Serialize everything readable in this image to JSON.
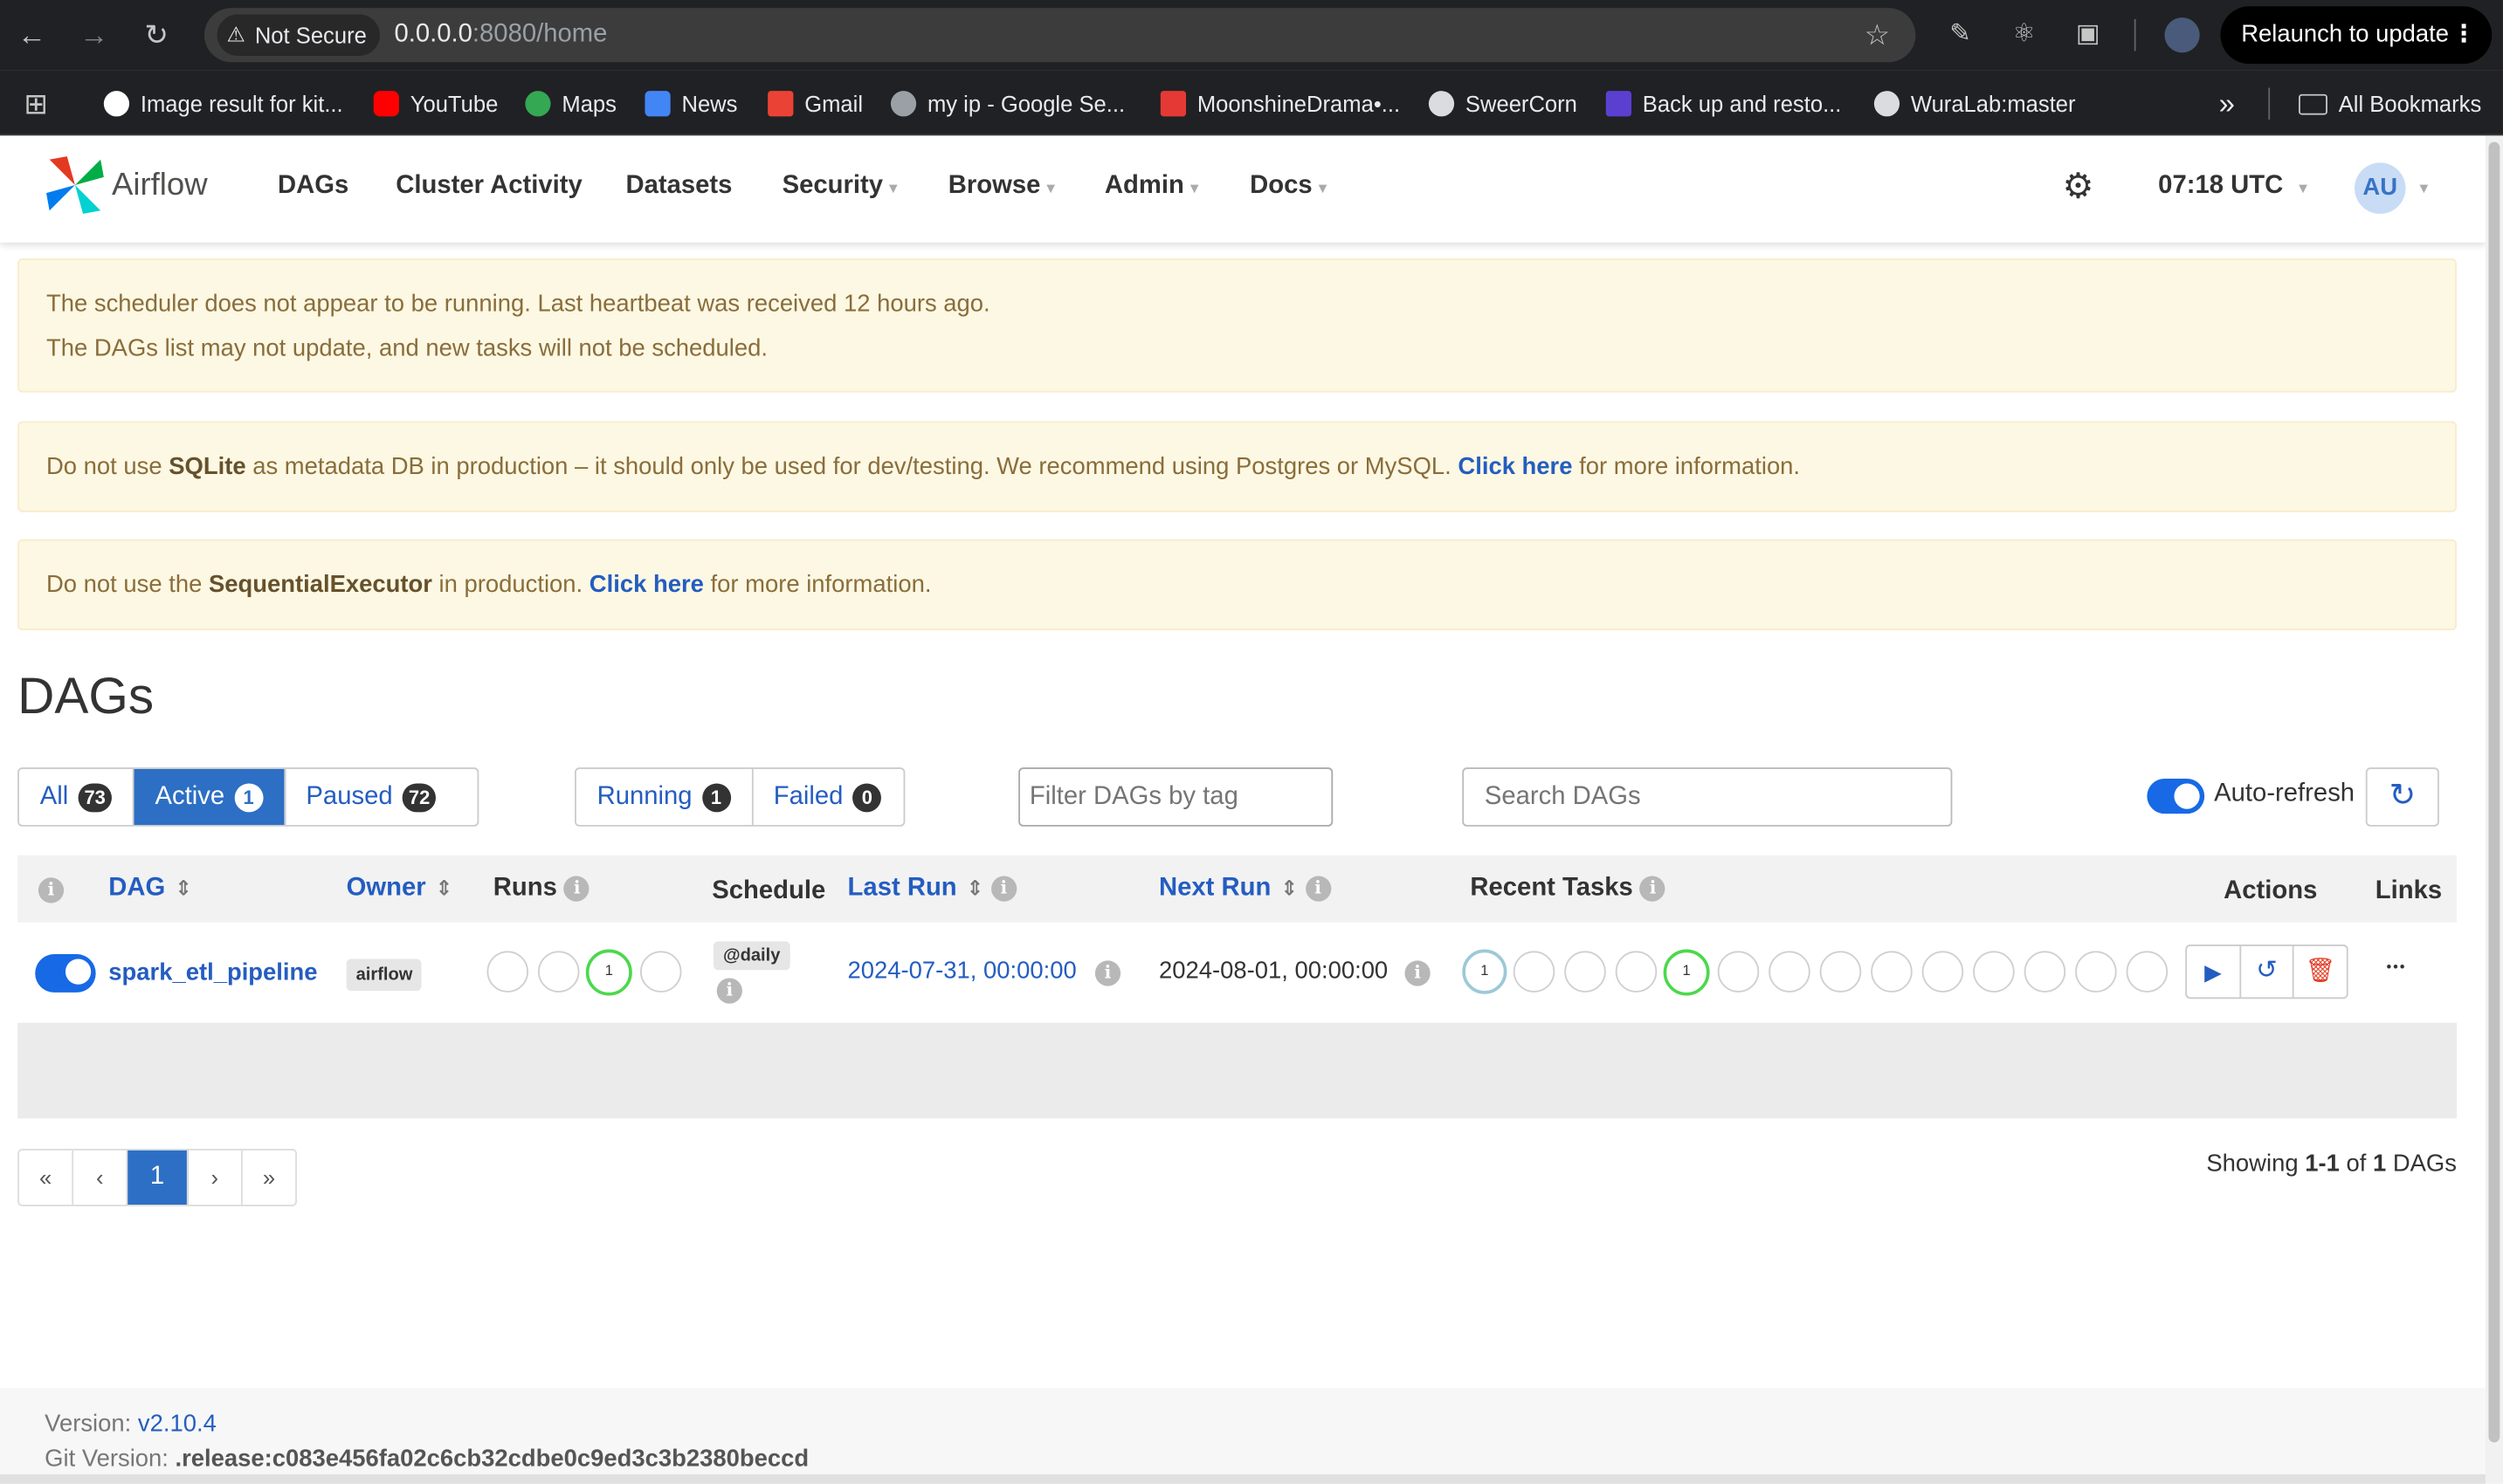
{
  "browser": {
    "not_secure": "Not Secure",
    "url_host": "0.0.0.0",
    "url_rest": ":8080/home",
    "relaunch": "Relaunch to update",
    "bookmarks": [
      {
        "label": "Image result for kit...",
        "color": "#ffffff"
      },
      {
        "label": "YouTube",
        "color": "#ff0000"
      },
      {
        "label": "Maps",
        "color": "#34a853"
      },
      {
        "label": "News",
        "color": "#4285f4"
      },
      {
        "label": "Gmail",
        "color": "#ea4335"
      },
      {
        "label": "my ip - Google Se...",
        "color": "#9aa0a6"
      },
      {
        "label": "MoonshineDrama•...",
        "color": "#e53935"
      },
      {
        "label": "SweerCorn",
        "color": "#dadce0"
      },
      {
        "label": "Back up and resto...",
        "color": "#5b3fd1"
      },
      {
        "label": "WuraLab:master",
        "color": "#dadce0"
      }
    ],
    "all_bookmarks": "All Bookmarks",
    "overflow": "»"
  },
  "nav": {
    "logo": "Airflow",
    "items": [
      "DAGs",
      "Cluster Activity",
      "Datasets",
      "Security",
      "Browse",
      "Admin",
      "Docs"
    ],
    "time": "07:18 UTC",
    "avatar": "AU"
  },
  "alerts": {
    "scheduler_line1": "The scheduler does not appear to be running. Last heartbeat was received 12 hours ago.",
    "scheduler_line2": "The DAGs list may not update, and new tasks will not be scheduled.",
    "sqlite_pre": "Do not use ",
    "sqlite_b": "SQLite",
    "sqlite_mid": " as metadata DB in production – it should only be used for dev/testing. We recommend using Postgres or MySQL. ",
    "sqlite_link": "Click here",
    "sqlite_post": " for more information.",
    "exec_pre": "Do not use the ",
    "exec_b": "SequentialExecutor",
    "exec_mid": " in production. ",
    "exec_link": "Click here",
    "exec_post": " for more information."
  },
  "page_title": "DAGs",
  "filters": {
    "all": {
      "label": "All",
      "count": "73"
    },
    "active": {
      "label": "Active",
      "count": "1"
    },
    "paused": {
      "label": "Paused",
      "count": "72"
    },
    "running": {
      "label": "Running",
      "count": "1"
    },
    "failed": {
      "label": "Failed",
      "count": "0"
    },
    "tag_placeholder": "Filter DAGs by tag",
    "search_placeholder": "Search DAGs",
    "autorefresh": "Auto-refresh"
  },
  "table": {
    "headers": {
      "dag": "DAG",
      "owner": "Owner",
      "runs": "Runs",
      "schedule": "Schedule",
      "last_run": "Last Run",
      "next_run": "Next Run",
      "recent_tasks": "Recent Tasks",
      "actions": "Actions",
      "links": "Links"
    },
    "row": {
      "dag_id": "spark_etl_pipeline",
      "owner": "airflow",
      "runs_count": "1",
      "schedule": "@daily",
      "last_run": "2024-07-31, 00:00:00",
      "next_run": "2024-08-01, 00:00:00",
      "task_count_a": "1",
      "task_count_b": "1",
      "links_more": "•••"
    }
  },
  "pagination": {
    "first": "«",
    "prev": "‹",
    "current": "1",
    "next": "›",
    "last": "»",
    "showing_pre": "Showing ",
    "range": "1-1",
    "of": " of ",
    "total": "1",
    "suffix": " DAGs"
  },
  "footer": {
    "version_label": "Version: ",
    "version": "v2.10.4",
    "git_label": "Git Version: ",
    "git": ".release:c083e456fa02c6cb32cdbe0c9ed3c3b2380beccd"
  }
}
